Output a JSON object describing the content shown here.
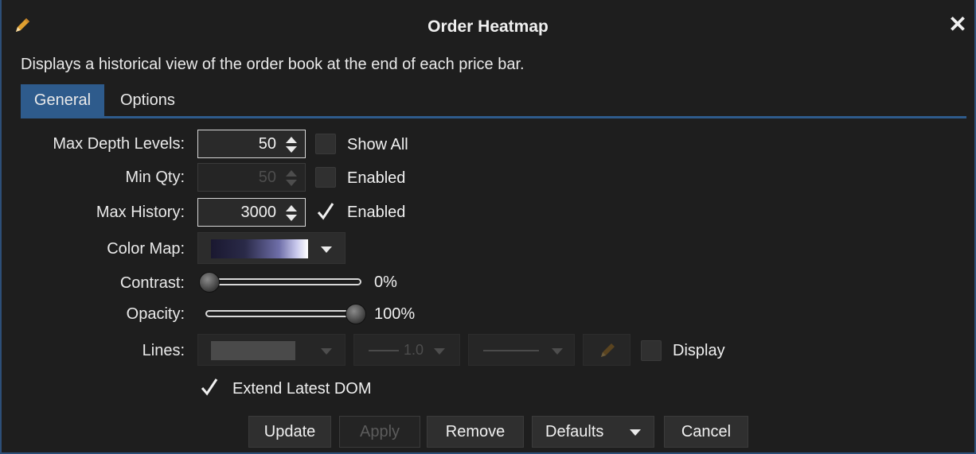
{
  "window": {
    "title": "Order Heatmap",
    "description": "Displays a historical view of the order book at the end of each price bar."
  },
  "tabs": [
    {
      "label": "General",
      "active": true
    },
    {
      "label": "Options",
      "active": false
    }
  ],
  "form": {
    "max_depth_levels": {
      "label": "Max Depth Levels:",
      "value": "50",
      "checkbox_label": "Show All",
      "checked": false
    },
    "min_qty": {
      "label": "Min Qty:",
      "value": "50",
      "checkbox_label": "Enabled",
      "checked": false,
      "disabled": true
    },
    "max_history": {
      "label": "Max History:",
      "value": "3000",
      "checkbox_label": "Enabled",
      "checked": true
    },
    "color_map": {
      "label": "Color Map:"
    },
    "contrast": {
      "label": "Contrast:",
      "value": "0%",
      "level": 0
    },
    "opacity": {
      "label": "Opacity:",
      "value": "100%",
      "level": 1
    },
    "lines": {
      "label": "Lines:",
      "width_value": "1.0",
      "display_label": "Display",
      "display_checked": false
    },
    "extend_latest_dom": {
      "label": "Extend Latest DOM",
      "checked": true
    }
  },
  "buttons": {
    "update": "Update",
    "apply": "Apply",
    "remove": "Remove",
    "defaults": "Defaults",
    "cancel": "Cancel"
  },
  "colors": {
    "accent": "#2e5b8c",
    "background": "#1e1e1e",
    "pencil": "#e0a030"
  },
  "icons": {
    "title_icon": "pencil-icon",
    "close": "close-icon",
    "spinner": "up-down-arrows-icon",
    "check": "checkmark-icon",
    "dropdown": "caret-down-icon",
    "lines_edit": "pencil-icon"
  }
}
